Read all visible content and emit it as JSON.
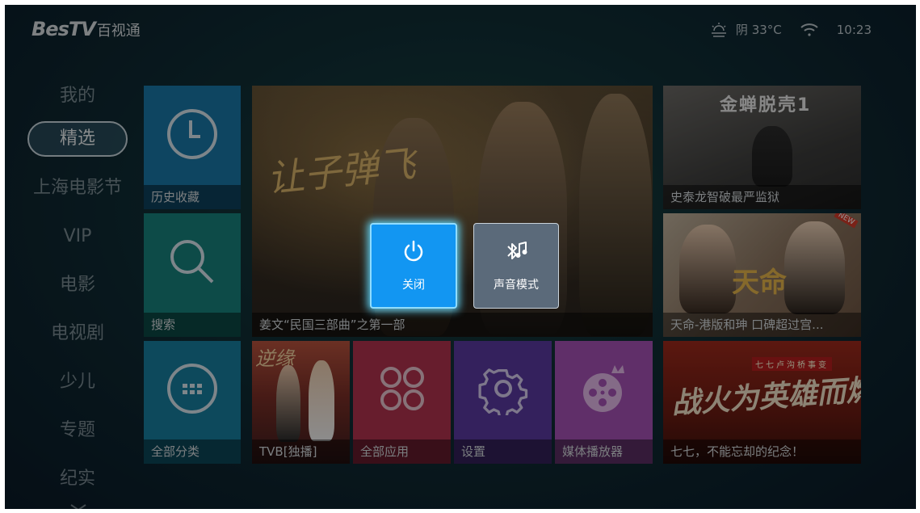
{
  "header": {
    "logo_main": "BesTV",
    "logo_sub": "百视通",
    "weather": "阴 33°C",
    "time": "10:23"
  },
  "nav": {
    "items": [
      "我的",
      "精选",
      "上海电影节",
      "VIP",
      "电影",
      "电视剧",
      "少儿",
      "专题",
      "纪实"
    ],
    "active": "精选"
  },
  "tiles": {
    "history": "历史收藏",
    "search": "搜索",
    "categories": "全部分类",
    "featured": "姜文“民国三部曲”之第一部",
    "featured_poster_title": "让子弹飞",
    "tvb": "TVB[独播]",
    "tvb_poster_title": "逆缘",
    "apps": "全部应用",
    "settings": "设置",
    "media_player": "媒体播放器",
    "right1": "史泰龙智破最严监狱",
    "right1_poster_title": "金蝉脱壳1",
    "right2": "天命-港版和珅 口碑超过宫...",
    "right2_poster_title": "天命",
    "right2_badge": "NEW",
    "right3": "七七，不能忘却的纪念！",
    "right3_poster_title": "战火为英雄而燃",
    "right3_banner": "七七卢沟桥事变"
  },
  "dialog": {
    "power_off": "关闭",
    "sound_mode": "声音模式"
  },
  "colors": {
    "dialog_active": "#1296f2",
    "dialog_glow": "#8fdcff",
    "nav_active_border": "#c9d6dc"
  },
  "icons": [
    "sun-cloud-icon",
    "wifi-icon",
    "clock-icon",
    "search-icon",
    "grid-icon",
    "apps-icon",
    "gear-icon",
    "film-reel-icon",
    "power-icon",
    "bluetooth-music-icon",
    "chevron-down-icon"
  ]
}
